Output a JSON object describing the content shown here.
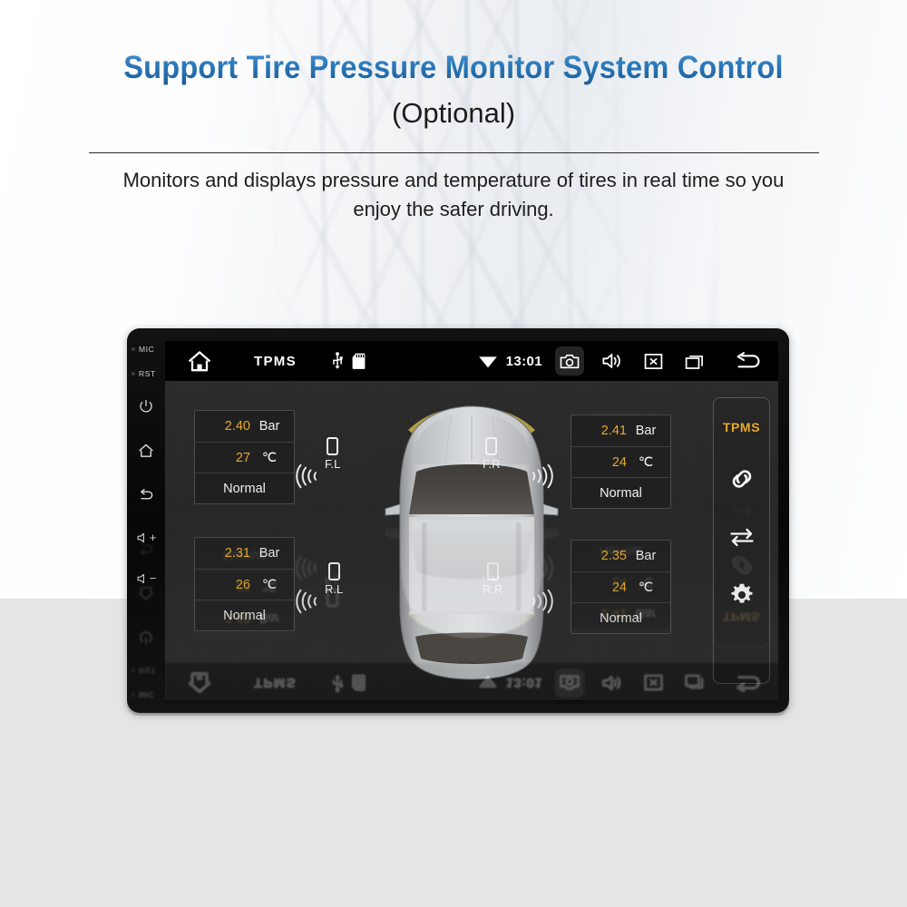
{
  "header": {
    "title": "Support Tire Pressure Monitor System Control",
    "subtitle": "(Optional)",
    "description": "Monitors and displays pressure and temperature of tires in real time so you enjoy the safer driving.",
    "title_color": "#2a77b8"
  },
  "device": {
    "bezel": {
      "mic_label": "MIC",
      "rst_label": "RST",
      "buttons": [
        {
          "name": "power",
          "label": ""
        },
        {
          "name": "home",
          "label": ""
        },
        {
          "name": "back",
          "label": ""
        },
        {
          "name": "volume-up",
          "label": "+"
        },
        {
          "name": "volume-down",
          "label": "−"
        }
      ]
    },
    "statusbar": {
      "home_icon": "home-icon",
      "app_title": "TPMS",
      "usb_icon": "usb-icon",
      "sdcard_icon": "sd-card-icon",
      "wifi_icon": "wifi-icon",
      "clock": "13:01",
      "camera_icon": "camera-icon",
      "volume_icon": "speaker-icon",
      "close_icon": "close-box-icon",
      "recents_icon": "recent-apps-icon",
      "back_icon": "back-arrow-icon",
      "camera_highlighted": true
    }
  },
  "tpms": {
    "units": {
      "pressure": "Bar",
      "temperature": "℃"
    },
    "accent_color": "#e8a92b",
    "wheels": [
      {
        "id": "FL",
        "label": "F.L",
        "pressure": "2.40",
        "temperature": "27",
        "status": "Normal"
      },
      {
        "id": "FR",
        "label": "F.R",
        "pressure": "2.41",
        "temperature": "24",
        "status": "Normal"
      },
      {
        "id": "RL",
        "label": "R.L",
        "pressure": "2.31",
        "temperature": "26",
        "status": "Normal"
      },
      {
        "id": "RR",
        "label": "R.R",
        "pressure": "2.35",
        "temperature": "24",
        "status": "Normal"
      }
    ]
  },
  "sidebar": {
    "title": "TPMS",
    "items": [
      {
        "name": "pair-icon",
        "label": ""
      },
      {
        "name": "swap-icon",
        "label": ""
      },
      {
        "name": "gear-icon",
        "label": ""
      }
    ]
  }
}
